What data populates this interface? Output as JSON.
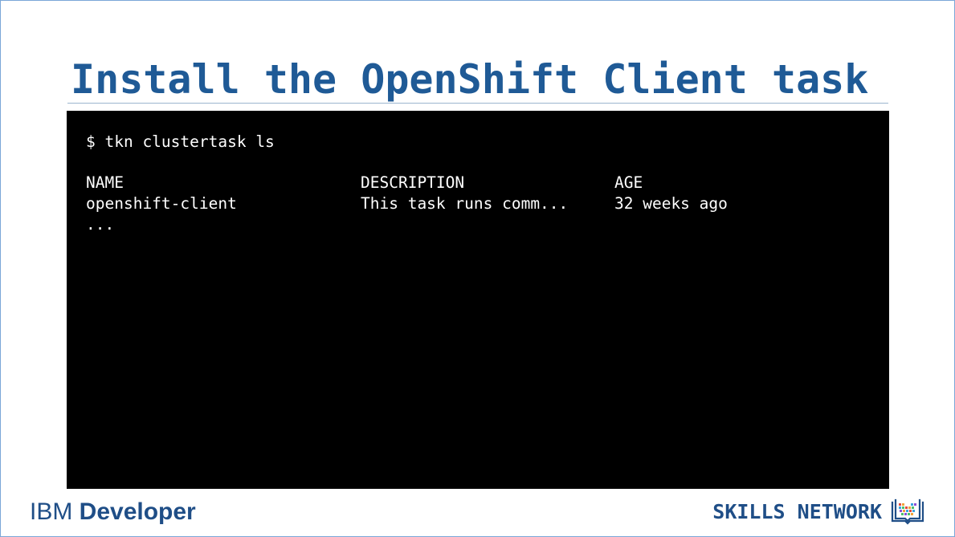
{
  "slide": {
    "title": "Install the OpenShift Client task"
  },
  "terminal": {
    "command": "$ tkn clustertask ls",
    "columns": [
      "NAME",
      "DESCRIPTION",
      "AGE"
    ],
    "rows": [
      [
        "openshift-client",
        "This task runs comm...",
        "32 weeks ago"
      ]
    ],
    "more": "..."
  },
  "footer": {
    "brand_left_light": "IBM ",
    "brand_left_bold": "Developer",
    "brand_right": "SKILLS NETWORK",
    "brand_right_icon": "book-pixel-icon"
  },
  "colors": {
    "title": "#1f5a96",
    "terminal_bg": "#000000",
    "terminal_fg": "#ffffff",
    "brand": "#1f4e87"
  }
}
